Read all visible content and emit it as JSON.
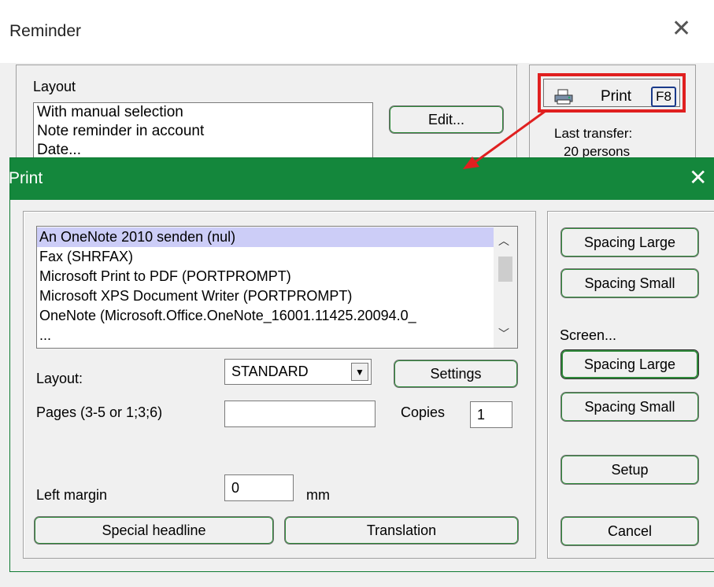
{
  "reminder": {
    "title": "Reminder",
    "layout_label": "Layout",
    "layout_items": [
      "With manual selection",
      "Note reminder in account",
      "Date..."
    ],
    "edit_button": "Edit...",
    "print_button": {
      "label": "Print",
      "shortcut": "F8"
    },
    "last_transfer_label": "Last transfer:",
    "last_transfer_value": "20 persons"
  },
  "print_dialog": {
    "title": "Print",
    "printers": [
      "An OneNote 2010 senden (nul)",
      "Fax (SHRFAX)",
      "Microsoft Print to PDF (PORTPROMPT)",
      "Microsoft XPS Document Writer (PORTPROMPT)",
      "OneNote (Microsoft.Office.OneNote_16001.11425.20094.0_",
      "..."
    ],
    "selected_printer_index": 0,
    "layout_label": "Layout:",
    "layout_value": "STANDARD",
    "settings_button": "Settings",
    "pages_label": "Pages (3-5 or 1;3;6)",
    "pages_value": "",
    "copies_label": "Copies",
    "copies_value": "1",
    "left_margin_label": "Left margin",
    "left_margin_value": "0",
    "margin_unit": "mm",
    "special_headline_button": "Special headline",
    "translation_button": "Translation",
    "right": {
      "spacing_large_1": "Spacing Large",
      "spacing_small_1": "Spacing Small",
      "screen_label": "Screen...",
      "spacing_large_2": "Spacing Large",
      "spacing_small_2": "Spacing Small",
      "setup_button": "Setup",
      "cancel_button": "Cancel"
    }
  },
  "colors": {
    "titlebar_green": "#14873c",
    "highlight_red": "#e02020",
    "selection": "#cccdf7"
  }
}
